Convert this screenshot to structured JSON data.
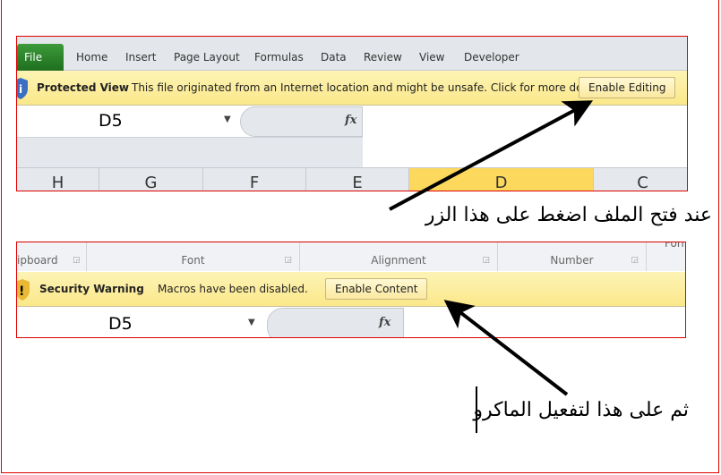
{
  "protected_view": {
    "file_tab": "File",
    "tabs": [
      "Home",
      "Insert",
      "Page Layout",
      "Formulas",
      "Data",
      "Review",
      "View",
      "Developer"
    ],
    "bar_title": "Protected View",
    "bar_message": "This file originated from an Internet location and might be unsafe. Click for more details.",
    "enable_button": "Enable Editing",
    "name_box": "D5",
    "fx": "fx",
    "columns": [
      "H",
      "G",
      "F",
      "E",
      "D",
      "C"
    ],
    "selected_column": "D"
  },
  "security_warning": {
    "groups": [
      "ipboard",
      "Font",
      "Alignment",
      "Number",
      "Forma"
    ],
    "bar_title": "Security Warning",
    "bar_message": "Macros have been disabled.",
    "enable_button": "Enable Content",
    "name_box": "D5",
    "fx": "fx"
  },
  "annotations": {
    "first": "عند فتح الملف اضغط على هذا الزر",
    "second": "ثم على هذا لتفعيل الماكرو"
  },
  "colors": {
    "frame": "#e00000",
    "warning_bar": "#fbe88a",
    "file_tab": "#2a7f2a",
    "selected_column": "#fcd85c"
  }
}
